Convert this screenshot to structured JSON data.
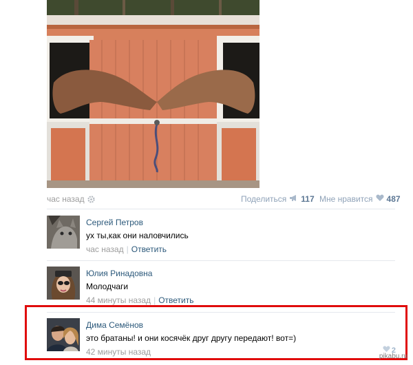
{
  "post": {
    "photo_icon": "horses-stable-photo",
    "time": "час назад",
    "share_label": "Поделиться",
    "share_count": "117",
    "like_label": "Мне нравится",
    "like_count": "487"
  },
  "comments": [
    {
      "name": "Сергей Петров",
      "text": "ух ты,как они наловчились",
      "time": "час назад",
      "reply": "Ответить",
      "avatar": "cat-avatar"
    },
    {
      "name": "Юлия Ринадовна",
      "text": "Молодчаги",
      "time": "44 минуты назад",
      "reply": "Ответить",
      "avatar": "girl-avatar"
    },
    {
      "name": "Дима Семёнов",
      "text": "это братаны! и они косячёк друг другу передают! вот=)",
      "time": "42 минуты назад",
      "likes": "2",
      "avatar": "couple-avatar"
    }
  ],
  "watermark": "pikabu.ru",
  "colors": {
    "link": "#2b587a",
    "muted": "#9c9c9c",
    "highlight": "#e00b0b"
  }
}
